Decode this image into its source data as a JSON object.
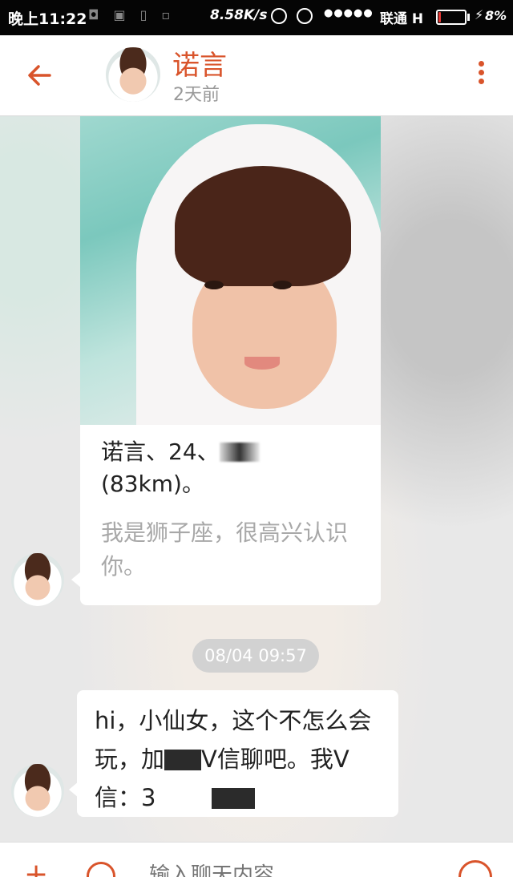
{
  "status_bar": {
    "time": "晚上11:22",
    "speed": "8.58K/s",
    "carrier": "联通",
    "network": "H",
    "battery": "8%",
    "battery_level": 0.08
  },
  "header": {
    "contact_name": "诺言",
    "contact_status": "2天前"
  },
  "profile_card": {
    "info_line1": "诺言、24、",
    "info_line2": "(83km)。",
    "bio": "我是狮子座，很高兴认识你。"
  },
  "timestamp": "08/04 09:57",
  "message": {
    "part1": "hi，小仙女，这个不怎么会玩，加",
    "part2": "V信聊吧。我V信：3"
  },
  "input": {
    "placeholder": "输入聊天内容"
  },
  "colors": {
    "accent": "#d9542b",
    "status_bar": "#050505"
  }
}
